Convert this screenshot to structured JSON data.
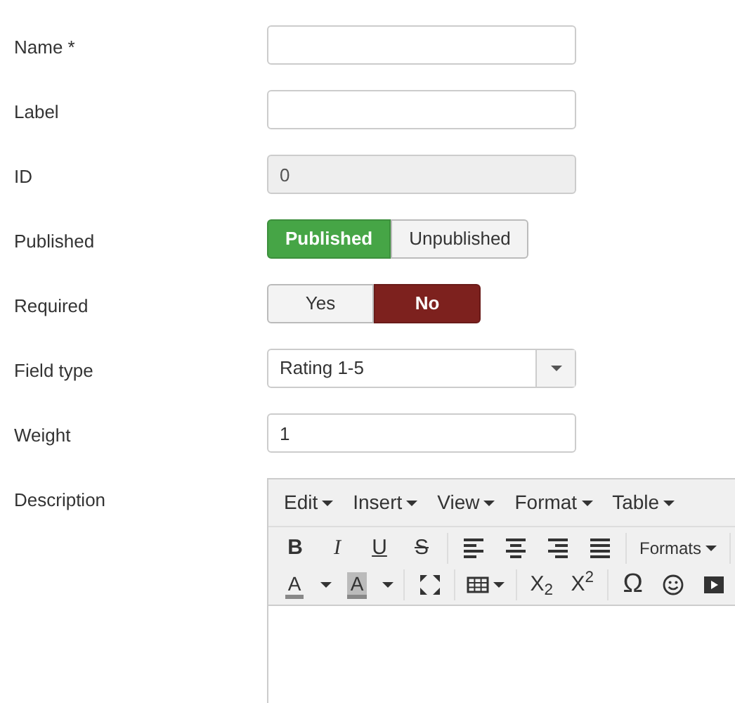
{
  "fields": [
    {
      "kind": "text",
      "label": "Name *"
    },
    {
      "kind": "text",
      "label": "Label"
    },
    {
      "kind": "readonly",
      "label": "ID",
      "value": "0"
    },
    {
      "kind": "status",
      "label": "Published",
      "options": [
        {
          "label": "Published",
          "selected": true
        },
        {
          "label": "Unpublished",
          "selected": false
        }
      ]
    },
    {
      "kind": "yesno",
      "label": "Required",
      "options": [
        {
          "label": "Yes",
          "selected": false
        },
        {
          "label": "No",
          "selected": true
        }
      ]
    },
    {
      "kind": "select",
      "label": "Field type",
      "value": "Rating 1-5"
    },
    {
      "kind": "text",
      "label": "Weight",
      "value": "1"
    },
    {
      "kind": "editor",
      "label": "Description",
      "menubar": [
        "Edit",
        "Insert",
        "View",
        "Format",
        "Table"
      ],
      "toolbars": [
        [
          {
            "kind": "bold",
            "text": "B"
          },
          {
            "kind": "italic",
            "text": "I"
          },
          {
            "kind": "underline",
            "text": "U"
          },
          {
            "kind": "strike",
            "text": "S"
          },
          {
            "kind": "separator"
          },
          {
            "kind": "align-left"
          },
          {
            "kind": "align-center"
          },
          {
            "kind": "align-right"
          },
          {
            "kind": "justify"
          },
          {
            "kind": "separator"
          },
          {
            "kind": "dropdown",
            "text": "Formats"
          },
          {
            "kind": "separator"
          }
        ],
        [
          {
            "kind": "textcolor",
            "text": "A"
          },
          {
            "kind": "caret"
          },
          {
            "kind": "bgcolor",
            "text": "A"
          },
          {
            "kind": "caret"
          },
          {
            "kind": "separator"
          },
          {
            "kind": "fullscreen"
          },
          {
            "kind": "separator"
          },
          {
            "kind": "table"
          },
          {
            "kind": "separator"
          },
          {
            "kind": "char",
            "text": "X$_{2}$"
          },
          {
            "kind": "char",
            "text": "X$^{2}$"
          },
          {
            "kind": "separator"
          },
          {
            "kind": "symbol",
            "text": "Ω"
          },
          {
            "kind": "emoji"
          },
          {
            "kind": "media"
          }
        ]
      ]
    }
  ]
}
